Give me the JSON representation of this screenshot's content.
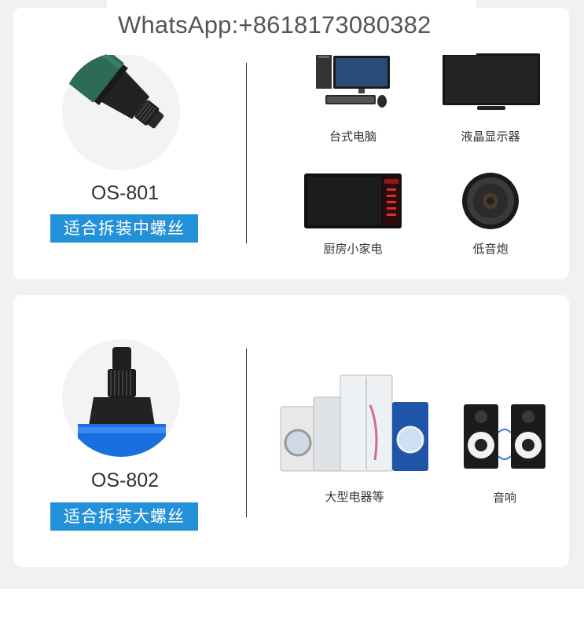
{
  "watermark": "WhatsApp:+8618173080382",
  "products": [
    {
      "model": "OS-801",
      "tag": "适合拆装中螺丝",
      "applications": [
        {
          "label": "台式电脑",
          "icon": "desktop-computer-icon"
        },
        {
          "label": "液晶显示器",
          "icon": "lcd-monitor-icon"
        },
        {
          "label": "厨房小家电",
          "icon": "microwave-icon"
        },
        {
          "label": "低音炮",
          "icon": "subwoofer-icon"
        }
      ]
    },
    {
      "model": "OS-802",
      "tag": "适合拆装大螺丝",
      "applications": [
        {
          "label": "大型电器等",
          "icon": "large-appliances-icon"
        },
        {
          "label": "音响",
          "icon": "speakers-icon"
        }
      ]
    }
  ],
  "colors": {
    "tag_bg": "#2391d8",
    "band_green": "#2e6b55",
    "band_blue": "#1a6fe0"
  }
}
